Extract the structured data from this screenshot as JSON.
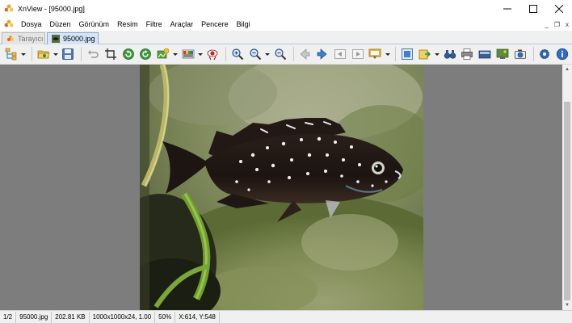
{
  "window": {
    "title": "XnView - [95000.jpg]",
    "controls": {
      "minimize": "—",
      "maximize": "☐",
      "close": "✕"
    }
  },
  "menu": {
    "items": [
      "Dosya",
      "Düzen",
      "Görünüm",
      "Resim",
      "Filtre",
      "Araçlar",
      "Pencere",
      "Bilgi"
    ],
    "mdi": {
      "minimize": "_",
      "restore": "❐",
      "close": "x"
    }
  },
  "tabs": [
    {
      "label": "Tarayıcı",
      "active": false
    },
    {
      "label": "95000.jpg",
      "active": true
    }
  ],
  "toolbar": {
    "buttons": [
      "browser-tree-icon",
      "open-folder-icon",
      "save-icon",
      "undo-icon",
      "crop-icon",
      "rotate-left-icon",
      "rotate-right-icon",
      "adjust-icon",
      "color-palette-icon",
      "red-eye-icon",
      "zoom-in-icon",
      "zoom-out-icon",
      "zoom-fit-icon",
      "previous-icon",
      "next-icon",
      "first-icon",
      "last-icon",
      "slideshow-icon",
      "fullscreen-icon",
      "export-icon",
      "find-icon",
      "print-icon",
      "scanner-icon",
      "wallpaper-icon",
      "capture-icon",
      "settings-icon",
      "info-icon"
    ]
  },
  "image": {
    "subject": "fish photo",
    "file": "95000.jpg"
  },
  "status": {
    "index": "1/2",
    "filename": "95000.jpg",
    "size": "202.81 KB",
    "dimensions": "1000x1000x24, 1.00",
    "zoom": "50%",
    "coords": "X:614, Y:548"
  }
}
